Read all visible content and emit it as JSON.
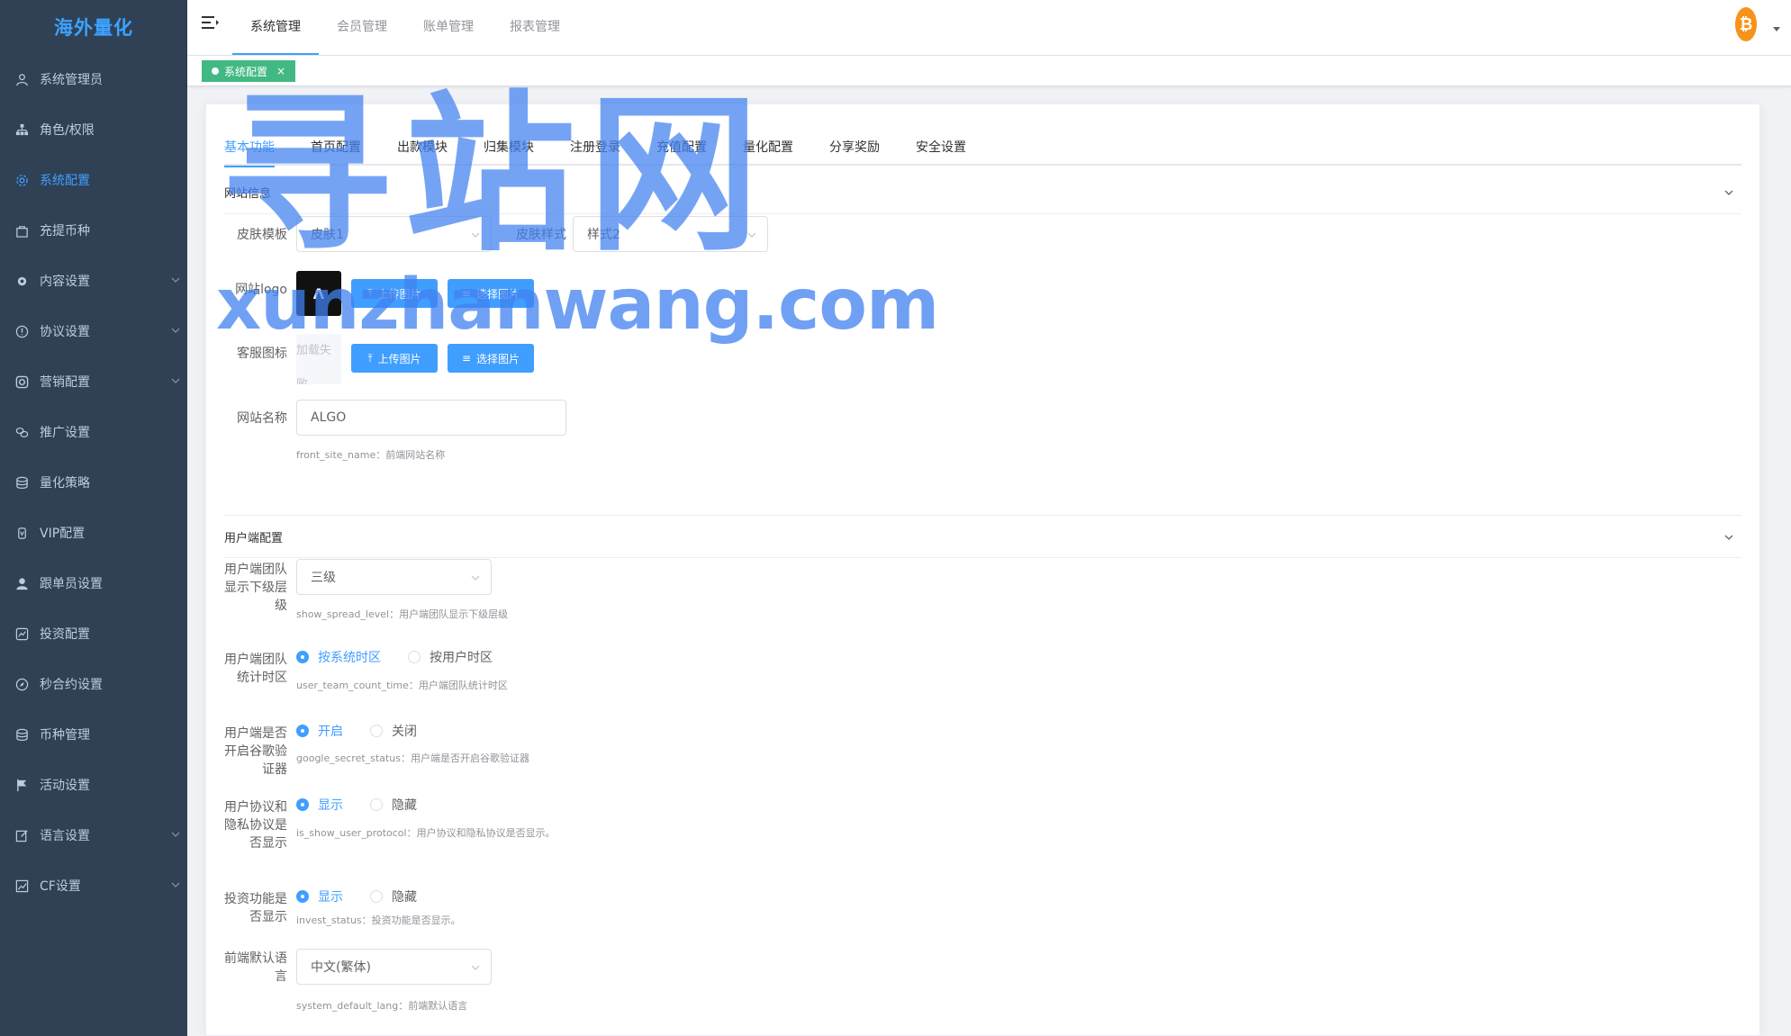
{
  "app": {
    "title": "海外量化"
  },
  "sidebar": {
    "items": [
      {
        "label": "系统管理员",
        "icon": "user-icon",
        "active": false,
        "expandable": false
      },
      {
        "label": "角色/权限",
        "icon": "tree-icon",
        "active": false,
        "expandable": false
      },
      {
        "label": "系统配置",
        "icon": "gear-icon",
        "active": true,
        "expandable": false
      },
      {
        "label": "充提币种",
        "icon": "bag-icon",
        "active": false,
        "expandable": false
      },
      {
        "label": "内容设置",
        "icon": "cog-icon",
        "active": false,
        "expandable": true
      },
      {
        "label": "协议设置",
        "icon": "info-icon",
        "active": false,
        "expandable": true
      },
      {
        "label": "营销配置",
        "icon": "marketing-icon",
        "active": false,
        "expandable": true
      },
      {
        "label": "推广设置",
        "icon": "link-icon",
        "active": false,
        "expandable": false
      },
      {
        "label": "量化策略",
        "icon": "database-icon",
        "active": false,
        "expandable": false
      },
      {
        "label": "VIP配置",
        "icon": "vip-icon",
        "active": false,
        "expandable": false
      },
      {
        "label": "跟单员设置",
        "icon": "person-icon",
        "active": false,
        "expandable": false
      },
      {
        "label": "投资配置",
        "icon": "invest-icon",
        "active": false,
        "expandable": false
      },
      {
        "label": "秒合约设置",
        "icon": "compass-icon",
        "active": false,
        "expandable": false
      },
      {
        "label": "币种管理",
        "icon": "coin-icon",
        "active": false,
        "expandable": false
      },
      {
        "label": "活动设置",
        "icon": "flag-icon",
        "active": false,
        "expandable": false
      },
      {
        "label": "语言设置",
        "icon": "edit-icon",
        "active": false,
        "expandable": true
      },
      {
        "label": "CF设置",
        "icon": "chart-icon",
        "active": false,
        "expandable": true
      }
    ]
  },
  "header": {
    "nav": [
      "系统管理",
      "会员管理",
      "账单管理",
      "报表管理"
    ],
    "active_nav": 0,
    "avatar_glyph": "₿"
  },
  "tags_view": {
    "tag_label": "系统配置",
    "close": "×"
  },
  "tabs": [
    "基本功能",
    "首页配置",
    "出款模块",
    "归集模块",
    "注册登录",
    "充值配置",
    "量化配置",
    "分享奖励",
    "安全设置"
  ],
  "active_tab": 0,
  "site_section": {
    "title": "网站信息",
    "skin_template_label": "皮肤模板",
    "skin_template_value": "皮肤1",
    "skin_style_label": "皮肤样式",
    "skin_style_value": "样式2",
    "logo_label": "网站logo",
    "logo_glyph": "Λ",
    "upload_label": "上传图片",
    "select_label": "选择图片",
    "service_icon_label": "客服图标",
    "broken_image_text": "加载失败",
    "site_name_label": "网站名称",
    "site_name_value": "ALGO",
    "site_name_hint": "front_site_name：前端网站名称"
  },
  "user_section": {
    "title": "用户端配置",
    "team_level_label": "用户端团队显示下级层级",
    "team_level_value": "三级",
    "team_level_hint": "show_spread_level：用户端团队显示下级层级",
    "team_time_label": "用户端团队统计时区",
    "team_time_options": [
      "按系统时区",
      "按用户时区"
    ],
    "team_time_hint": "user_team_count_time：用户端团队统计时区",
    "google_label": "用户端是否开启谷歌验证器",
    "google_options": [
      "开启",
      "关闭"
    ],
    "google_hint": "google_secret_status：用户端是否开启谷歌验证器",
    "protocol_label": "用户协议和隐私协议是否显示",
    "protocol_options": [
      "显示",
      "隐藏"
    ],
    "protocol_hint": "is_show_user_protocol：用户协议和隐私协议是否显示。",
    "invest_label": "投资功能是否显示",
    "invest_options": [
      "显示",
      "隐藏"
    ],
    "invest_hint": "invest_status：投资功能是否显示。",
    "lang_label": "前端默认语言",
    "lang_value": "中文(繁体)",
    "lang_hint": "system_default_lang：前端默认语言"
  },
  "watermark": {
    "cn": "寻站网",
    "en": "xunzhanwang.com"
  }
}
